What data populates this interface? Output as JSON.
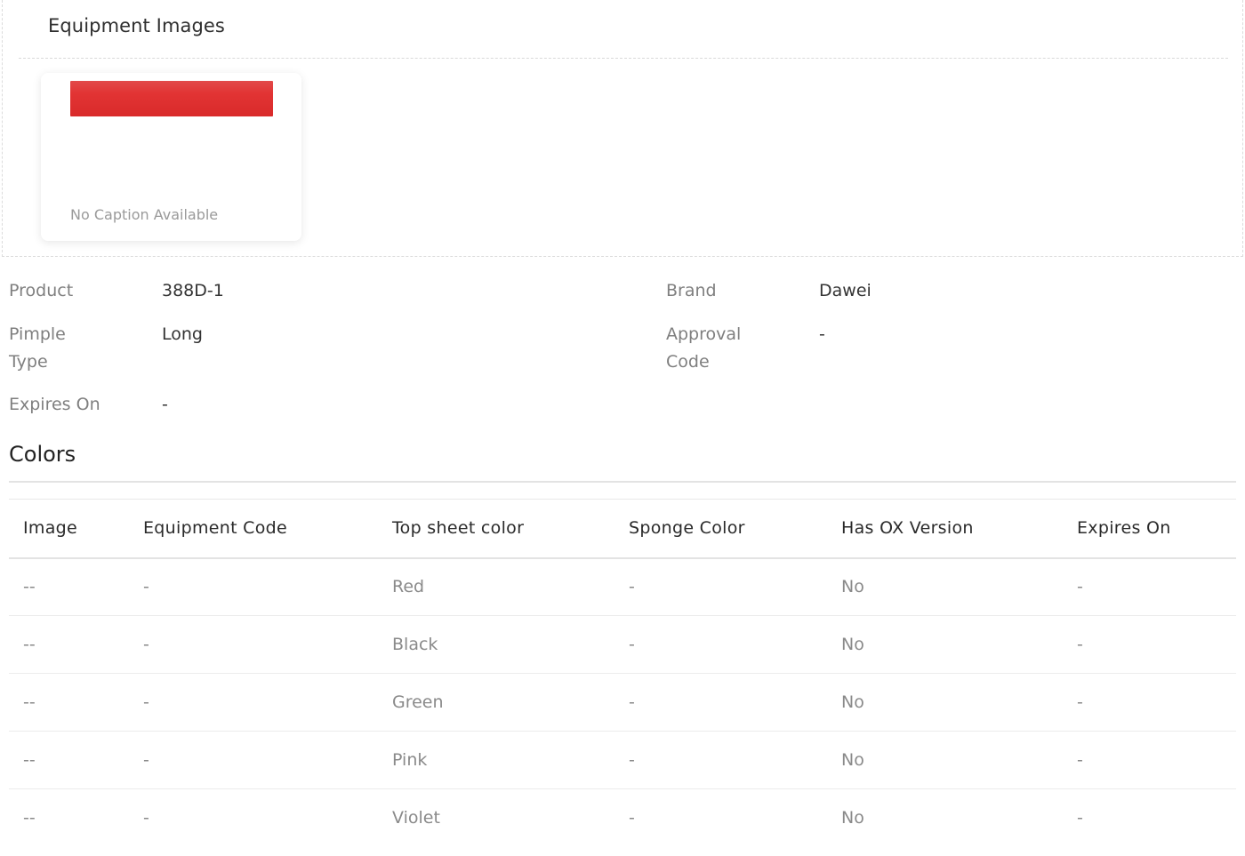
{
  "images_section": {
    "title": "Equipment Images",
    "card": {
      "caption": "No Caption Available",
      "thumb_color": "#e03030"
    }
  },
  "details": {
    "product": {
      "label": "Product",
      "value": "388D-1"
    },
    "pimple_type": {
      "label_line1": "Pimple",
      "label_line2": "Type",
      "value": "Long"
    },
    "expires_on": {
      "label": "Expires On",
      "value": "-"
    },
    "brand": {
      "label": "Brand",
      "value": "Dawei"
    },
    "approval_code": {
      "label_line1": "Approval",
      "label_line2": "Code",
      "value": "-"
    }
  },
  "colors": {
    "title": "Colors",
    "columns": [
      "Image",
      "Equipment Code",
      "Top sheet color",
      "Sponge Color",
      "Has OX Version",
      "Expires On"
    ],
    "rows": [
      [
        "--",
        "-",
        "Red",
        "-",
        "No",
        "-"
      ],
      [
        "--",
        "-",
        "Black",
        "-",
        "No",
        "-"
      ],
      [
        "--",
        "-",
        "Green",
        "-",
        "No",
        "-"
      ],
      [
        "--",
        "-",
        "Pink",
        "-",
        "No",
        "-"
      ],
      [
        "--",
        "-",
        "Violet",
        "-",
        "No",
        "-"
      ]
    ]
  }
}
